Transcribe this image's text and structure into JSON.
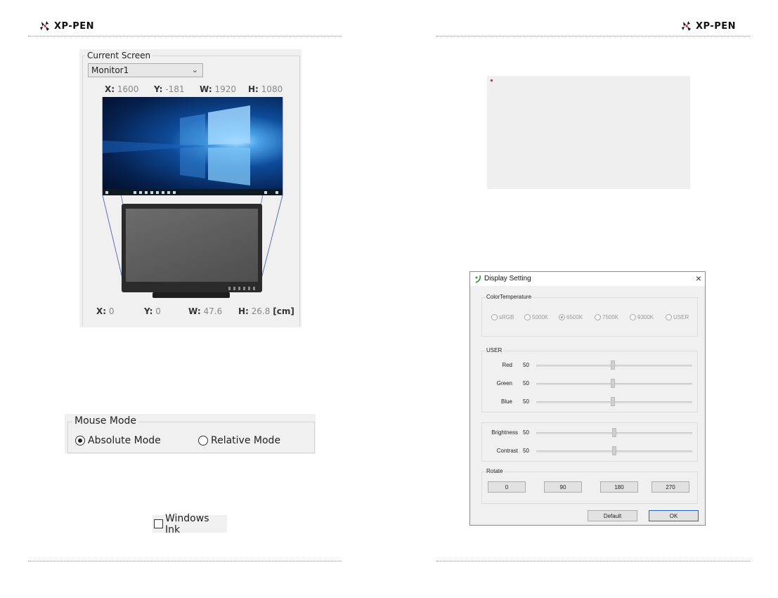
{
  "brand": {
    "name": "XP-PEN"
  },
  "current_screen": {
    "title": "Current Screen",
    "monitor": "Monitor1",
    "monitor_coords": {
      "x_label": "X:",
      "x": "1600",
      "y_label": "Y:",
      "y": "-181",
      "w_label": "W:",
      "w": "1920",
      "h_label": "H:",
      "h": "1080"
    },
    "tablet_coords": {
      "x_label": "X:",
      "x": "0",
      "y_label": "Y:",
      "y": "0",
      "w_label": "W:",
      "w": "47.6",
      "h_label": "H:",
      "h": "26.8",
      "unit": "[cm]"
    }
  },
  "mouse_mode": {
    "title": "Mouse Mode",
    "absolute_label": "Absolute Mode",
    "relative_label": "Relative Mode",
    "selected": "Absolute Mode"
  },
  "windows_ink": {
    "label": "Windows Ink",
    "checked": false
  },
  "display_setting": {
    "title": "Display Setting",
    "color_temperature": {
      "title": "ColorTemperature",
      "options": [
        "sRGB",
        "5000K",
        "6500K",
        "7500K",
        "9300K",
        "USER"
      ],
      "selected": "6500K"
    },
    "user": {
      "title": "USER",
      "sliders": [
        {
          "label": "Red",
          "value": "50"
        },
        {
          "label": "Green",
          "value": "50"
        },
        {
          "label": "Blue",
          "value": "50"
        }
      ]
    },
    "picture": {
      "sliders": [
        {
          "label": "Brightness",
          "value": "50"
        },
        {
          "label": "Contrast",
          "value": "50"
        }
      ]
    },
    "rotate": {
      "title": "Rotate",
      "options": [
        "0",
        "90",
        "180",
        "270"
      ]
    },
    "buttons": {
      "default": "Default",
      "ok": "OK"
    },
    "close_icon": "×"
  },
  "icons": [
    "xp-pen-logo-icon",
    "chevron-down-icon",
    "close-icon",
    "app-icon"
  ]
}
